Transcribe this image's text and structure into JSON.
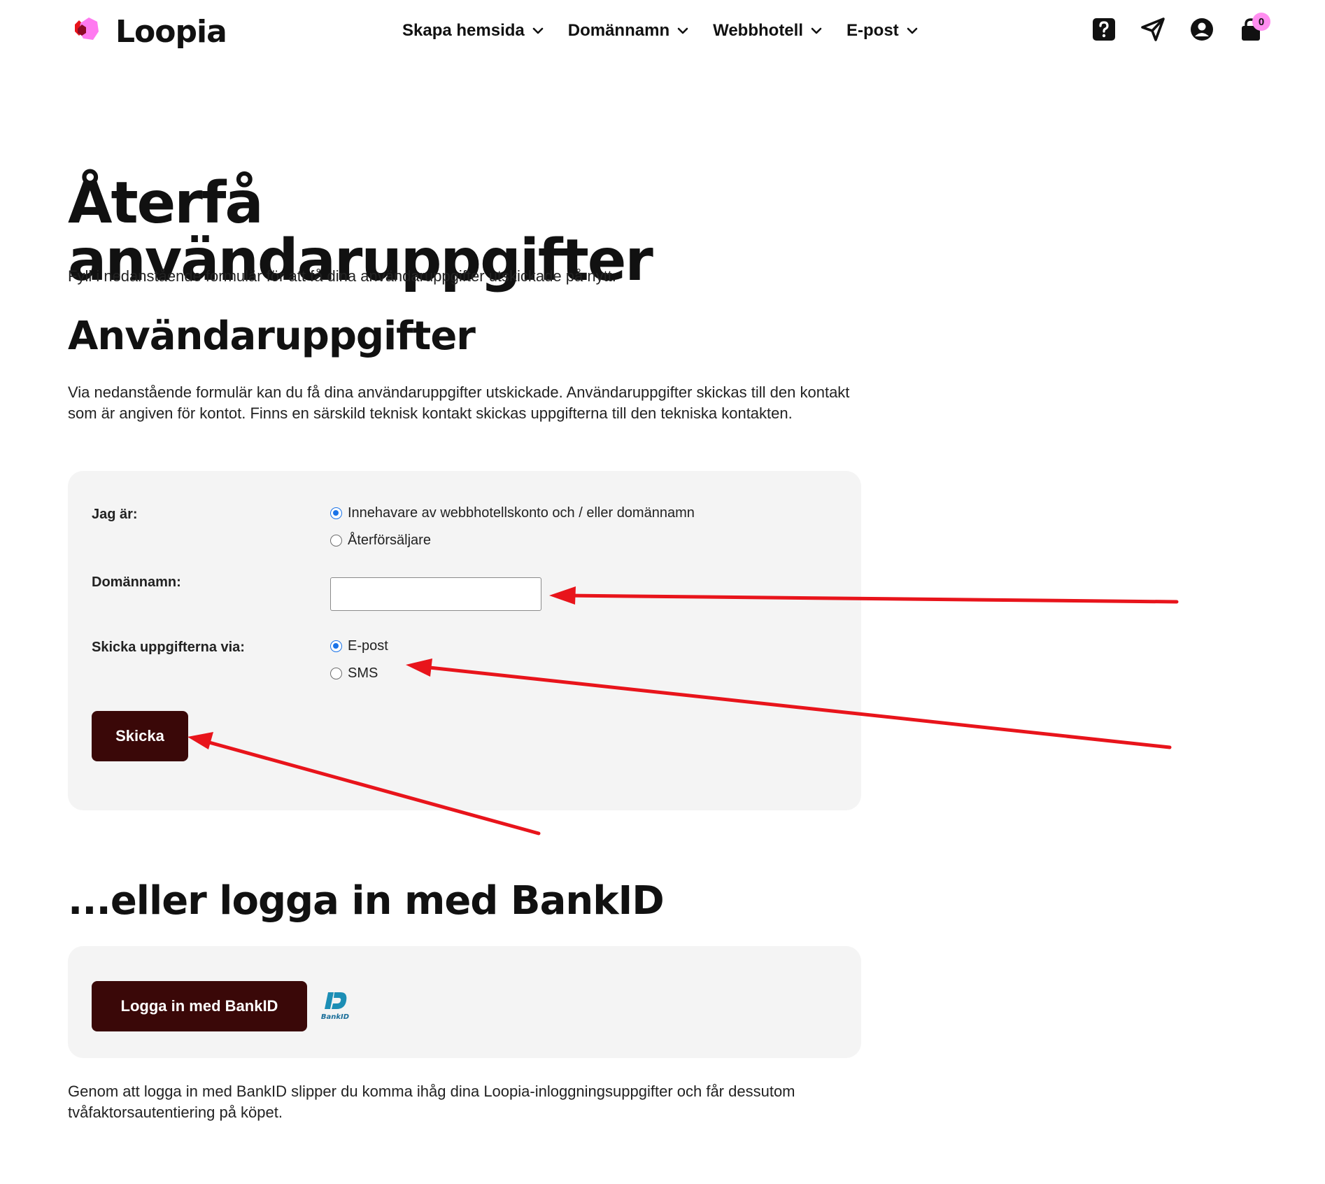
{
  "header": {
    "brand": "Loopia",
    "nav": [
      {
        "label": "Skapa hemsida"
      },
      {
        "label": "Domännamn"
      },
      {
        "label": "Webbhotell"
      },
      {
        "label": "E-post"
      }
    ],
    "cart_count": "0"
  },
  "page": {
    "title": "Återfå användaruppgifter",
    "intro": "Fyll i nedanstående formulär för att få dina användaruppgifter utskickade på nytt.",
    "section_title": "Användaruppgifter",
    "section_desc": "Via nedanstående formulär kan du få dina användaruppgifter utskickade. Användaruppgifter skickas till den kontakt som är angiven för kontot. Finns en särskild teknisk kontakt skickas uppgifterna till den tekniska kontakten."
  },
  "form": {
    "role_label": "Jag är:",
    "role_options": [
      {
        "label": "Innehavare av webbhotellskonto och / eller domännamn",
        "checked": true
      },
      {
        "label": "Återförsäljare",
        "checked": false
      }
    ],
    "domain_label": "Domännamn:",
    "domain_value": "",
    "send_label": "Skicka uppgifterna via:",
    "send_options": [
      {
        "label": "E-post",
        "checked": true
      },
      {
        "label": "SMS",
        "checked": false
      }
    ],
    "submit_label": "Skicka"
  },
  "bankid": {
    "title": "...eller logga in med BankID",
    "button_label": "Logga in med BankID",
    "logo_text": "BankID",
    "note": "Genom att logga in med BankID slipper du komma ihåg dina Loopia-inloggningsuppgifter och får dessutom tvåfaktorsautentiering på köpet."
  },
  "colors": {
    "accent_dark": "#3a0808",
    "card_bg": "#f4f4f4",
    "annotation_red": "#e8141b",
    "brand_pink": "#ff8ef0",
    "brand_red": "#e8141b",
    "radio_blue": "#1a73e8"
  }
}
